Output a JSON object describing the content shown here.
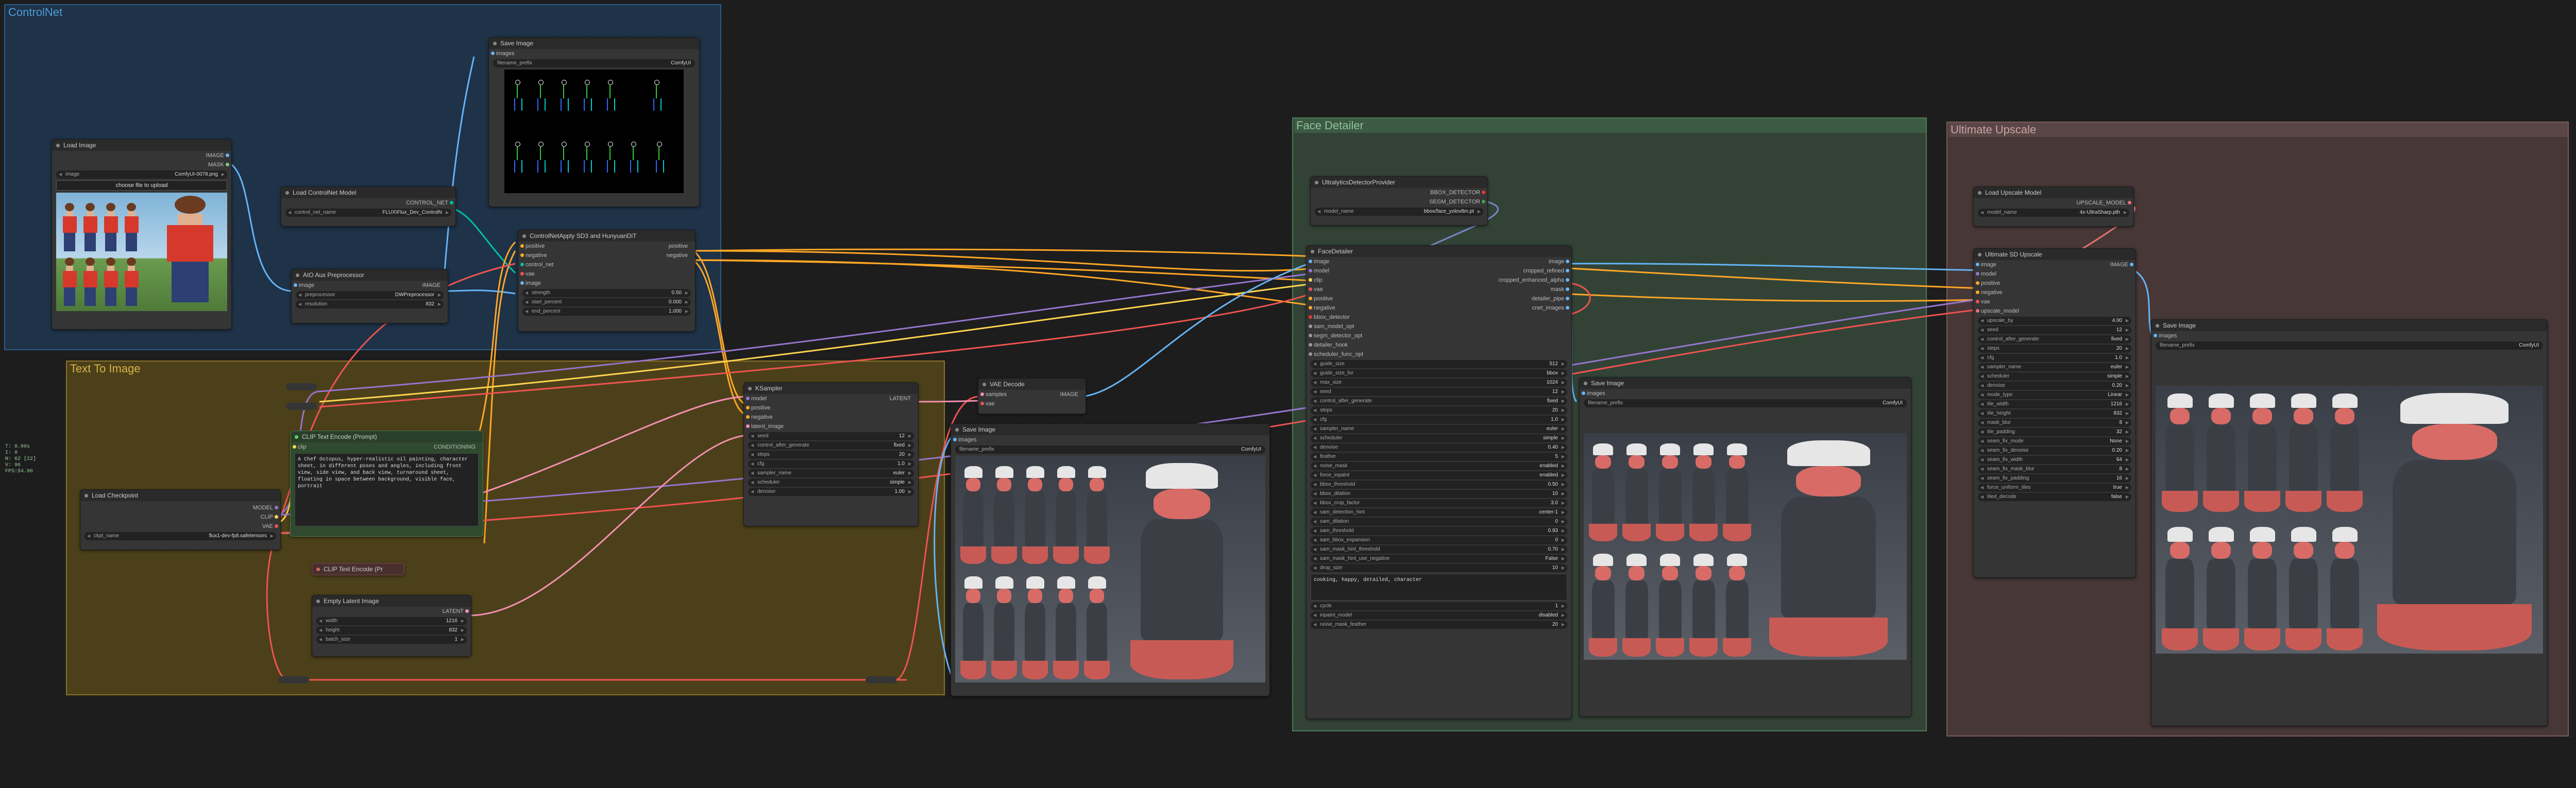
{
  "groups": {
    "controlnet": "ControlNet",
    "text_to_image": "Text To Image",
    "face_detailer": "Face Detailer",
    "ultimate_upscale": "Ultimate Upscale"
  },
  "colors": {
    "controlnet": "#1f3a57",
    "text_to_image": "#5a4a1a",
    "face_detailer": "#35483a",
    "ultimate_upscale": "#4c3b3b"
  },
  "stats": [
    "T: 0.00s",
    "I: 0",
    "N: 62 [22]",
    "V: 96",
    "FPS:54.90"
  ],
  "load_image": {
    "title": "Load Image",
    "out_image": "IMAGE",
    "out_mask": "MASK",
    "image_label": "image",
    "image_value": "ComfyUI-0078.png",
    "upload": "choose file to upload"
  },
  "save_image_cn": {
    "title": "Save Image",
    "in_images": "images",
    "prefix_label": "filename_prefix",
    "prefix_value": "ComfyUI"
  },
  "load_controlnet": {
    "title": "Load ControlNet Model",
    "out": "CONTROL_NET",
    "name_label": "control_net_name",
    "name_value": "FLUX\\Flux_Dev_ControlN"
  },
  "aio_pre": {
    "title": "AIO Aux Preprocessor",
    "in_image": "image",
    "out": "IMAGE",
    "pre_label": "preprocessor",
    "pre_value": "DWPreprocessor",
    "res_label": "resolution",
    "res_value": "832"
  },
  "cn_apply": {
    "title": "ControlNetApply SD3 and HunyuanDiT",
    "in": [
      "positive",
      "negative",
      "control_net",
      "vae",
      "image"
    ],
    "out": [
      "positive",
      "negative"
    ],
    "w": [
      [
        "strength",
        "0.50"
      ],
      [
        "start_percent",
        "0.000"
      ],
      [
        "end_percent",
        "1.000"
      ]
    ]
  },
  "ksampler": {
    "title": "KSampler",
    "in": [
      "model",
      "positive",
      "negative",
      "latent_image"
    ],
    "out": "LATENT",
    "w": [
      [
        "seed",
        "12"
      ],
      [
        "control_after_generate",
        "fixed"
      ],
      [
        "steps",
        "20"
      ],
      [
        "cfg",
        "1.0"
      ],
      [
        "sampler_name",
        "euler"
      ],
      [
        "scheduler",
        "simple"
      ],
      [
        "denoise",
        "1.00"
      ]
    ]
  },
  "vae_decode": {
    "title": "VAE Decode",
    "in": [
      "samples",
      "vae"
    ],
    "out": "IMAGE"
  },
  "save_image_t2i": {
    "title": "Save Image",
    "in_images": "images",
    "prefix_label": "filename_prefix",
    "prefix_value": "ComfyUI"
  },
  "clip_pos": {
    "title": "CLIP Text Encode (Prompt)",
    "in": "clip",
    "out": "CONDITIONING",
    "text": "A Chef Octopus, hyper-realistic oil painting, character sheet, in different poses and angles, including front view, side view, and back view, turnaround sheet, floating in space between background, visible face, portrait"
  },
  "clip_neg": {
    "title": "CLIP Text Encode (Pr"
  },
  "load_ckpt": {
    "title": "Load Checkpoint",
    "out": [
      "MODEL",
      "CLIP",
      "VAE"
    ],
    "name_label": "ckpt_name",
    "name_value": "flux1-dev-fp8.safetensors"
  },
  "empty_latent": {
    "title": "Empty Latent Image",
    "out": "LATENT",
    "w": [
      [
        "width",
        "1216"
      ],
      [
        "height",
        "832"
      ],
      [
        "batch_size",
        "1"
      ]
    ]
  },
  "ultra": {
    "title": "UltralyticsDetectorProvider",
    "out": [
      "BBOX_DETECTOR",
      "SEGM_DETECTOR"
    ],
    "name_label": "model_name",
    "name_value": "bbox/face_yolov8m.pt"
  },
  "face_detailer": {
    "title": "FaceDetailer",
    "in": [
      "image",
      "model",
      "clip",
      "vae",
      "positive",
      "negative",
      "bbox_detector",
      "sam_model_opt",
      "segm_detector_opt",
      "detailer_hook",
      "scheduler_func_opt"
    ],
    "out": [
      "image",
      "cropped_refined",
      "cropped_enhanced_alpha",
      "mask",
      "detailer_pipe",
      "cnet_images"
    ],
    "w": [
      [
        "guide_size",
        "512"
      ],
      [
        "guide_size_for",
        "bbox"
      ],
      [
        "max_size",
        "1024"
      ],
      [
        "seed",
        "12"
      ],
      [
        "control_after_generate",
        "fixed"
      ],
      [
        "steps",
        "20"
      ],
      [
        "cfg",
        "1.0"
      ],
      [
        "sampler_name",
        "euler"
      ],
      [
        "scheduler",
        "simple"
      ],
      [
        "denoise",
        "0.40"
      ],
      [
        "feather",
        "5"
      ],
      [
        "noise_mask",
        "enabled"
      ],
      [
        "force_inpaint",
        "enabled"
      ],
      [
        "bbox_threshold",
        "0.50"
      ],
      [
        "bbox_dilation",
        "10"
      ],
      [
        "bbox_crop_factor",
        "3.0"
      ],
      [
        "sam_detection_hint",
        "center-1"
      ],
      [
        "sam_dilation",
        "0"
      ],
      [
        "sam_threshold",
        "0.93"
      ],
      [
        "sam_bbox_expansion",
        "0"
      ],
      [
        "sam_mask_hint_threshold",
        "0.70"
      ],
      [
        "sam_mask_hint_use_negative",
        "False"
      ],
      [
        "drop_size",
        "10"
      ]
    ],
    "wildcard": "cooking, happy, detailed, character",
    "w2": [
      [
        "cycle",
        "1"
      ],
      [
        "inpaint_model",
        "disabled"
      ],
      [
        "noise_mask_feather",
        "20"
      ]
    ]
  },
  "save_image_fd": {
    "title": "Save Image",
    "in_images": "images",
    "prefix_label": "filename_prefix",
    "prefix_value": "ComfyUI"
  },
  "load_upscale": {
    "title": "Load Upscale Model",
    "out": "UPSCALE_MODEL",
    "name_label": "model_name",
    "name_value": "4x-UltraSharp.pth"
  },
  "usdu": {
    "title": "Ultimate SD Upscale",
    "in": [
      "image",
      "model",
      "positive",
      "negative",
      "vae",
      "upscale_model"
    ],
    "out": "IMAGE",
    "w": [
      [
        "upscale_by",
        "4.00"
      ],
      [
        "seed",
        "12"
      ],
      [
        "control_after_generate",
        "fixed"
      ],
      [
        "steps",
        "20"
      ],
      [
        "cfg",
        "1.0"
      ],
      [
        "sampler_name",
        "euler"
      ],
      [
        "scheduler",
        "simple"
      ],
      [
        "denoise",
        "0.20"
      ],
      [
        "mode_type",
        "Linear"
      ],
      [
        "tile_width",
        "1216"
      ],
      [
        "tile_height",
        "832"
      ],
      [
        "mask_blur",
        "8"
      ],
      [
        "tile_padding",
        "32"
      ],
      [
        "seam_fix_mode",
        "None"
      ],
      [
        "seam_fix_denoise",
        "0.20"
      ],
      [
        "seam_fix_width",
        "64"
      ],
      [
        "seam_fix_mask_blur",
        "8"
      ],
      [
        "seam_fix_padding",
        "16"
      ],
      [
        "force_uniform_tiles",
        "true"
      ],
      [
        "tiled_decode",
        "false"
      ]
    ]
  },
  "save_image_up": {
    "title": "Save Image",
    "in_images": "images",
    "prefix_label": "filename_prefix",
    "prefix_value": "ComfyUI"
  }
}
